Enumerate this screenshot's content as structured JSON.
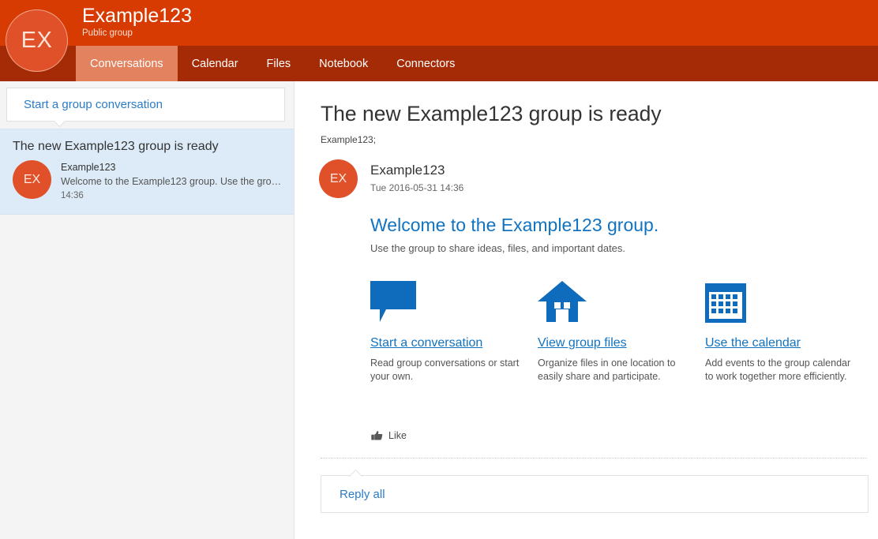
{
  "header": {
    "avatar_initials": "EX",
    "group_name": "Example123",
    "group_type": "Public group",
    "bg_color": "#d83b01"
  },
  "tabs": {
    "bg_color": "#a42b06",
    "active_bg_color": "#e2825e",
    "items": [
      {
        "label": "Conversations",
        "active": true
      },
      {
        "label": "Calendar",
        "active": false
      },
      {
        "label": "Files",
        "active": false
      },
      {
        "label": "Notebook",
        "active": false
      },
      {
        "label": "Connectors",
        "active": false
      }
    ]
  },
  "sidebar": {
    "start_conversation_label": "Start a group conversation",
    "selected_bg_color": "#dcebf7",
    "conversations": [
      {
        "subject": "The new Example123 group is ready",
        "avatar_initials": "EX",
        "sender": "Example123",
        "preview": "Welcome to the Example123 group. Use the group t...",
        "time": "14:36",
        "selected": true
      }
    ]
  },
  "message": {
    "title": "The new Example123 group is ready",
    "recipients": "Example123;",
    "avatar_initials": "EX",
    "sender_name": "Example123",
    "sent_date": "Tue 2016-05-31 14:36",
    "welcome_heading": "Welcome to the Example123 group.",
    "welcome_sub": "Use the group to share ideas, files, and important dates.",
    "accent_color": "#1273c0",
    "features": [
      {
        "icon": "speech-bubble-icon",
        "link": "Start a conversation",
        "description": "Read group conversations or start your own."
      },
      {
        "icon": "house-icon",
        "link": "View group files",
        "description": "Organize files in one location to easily share and participate."
      },
      {
        "icon": "calendar-icon",
        "link": "Use the calendar",
        "description": "Add events to the group calendar to work together more efficiently."
      }
    ],
    "like_label": "Like",
    "like_icon": "thumbs-up-icon",
    "reply_all_label": "Reply all"
  }
}
